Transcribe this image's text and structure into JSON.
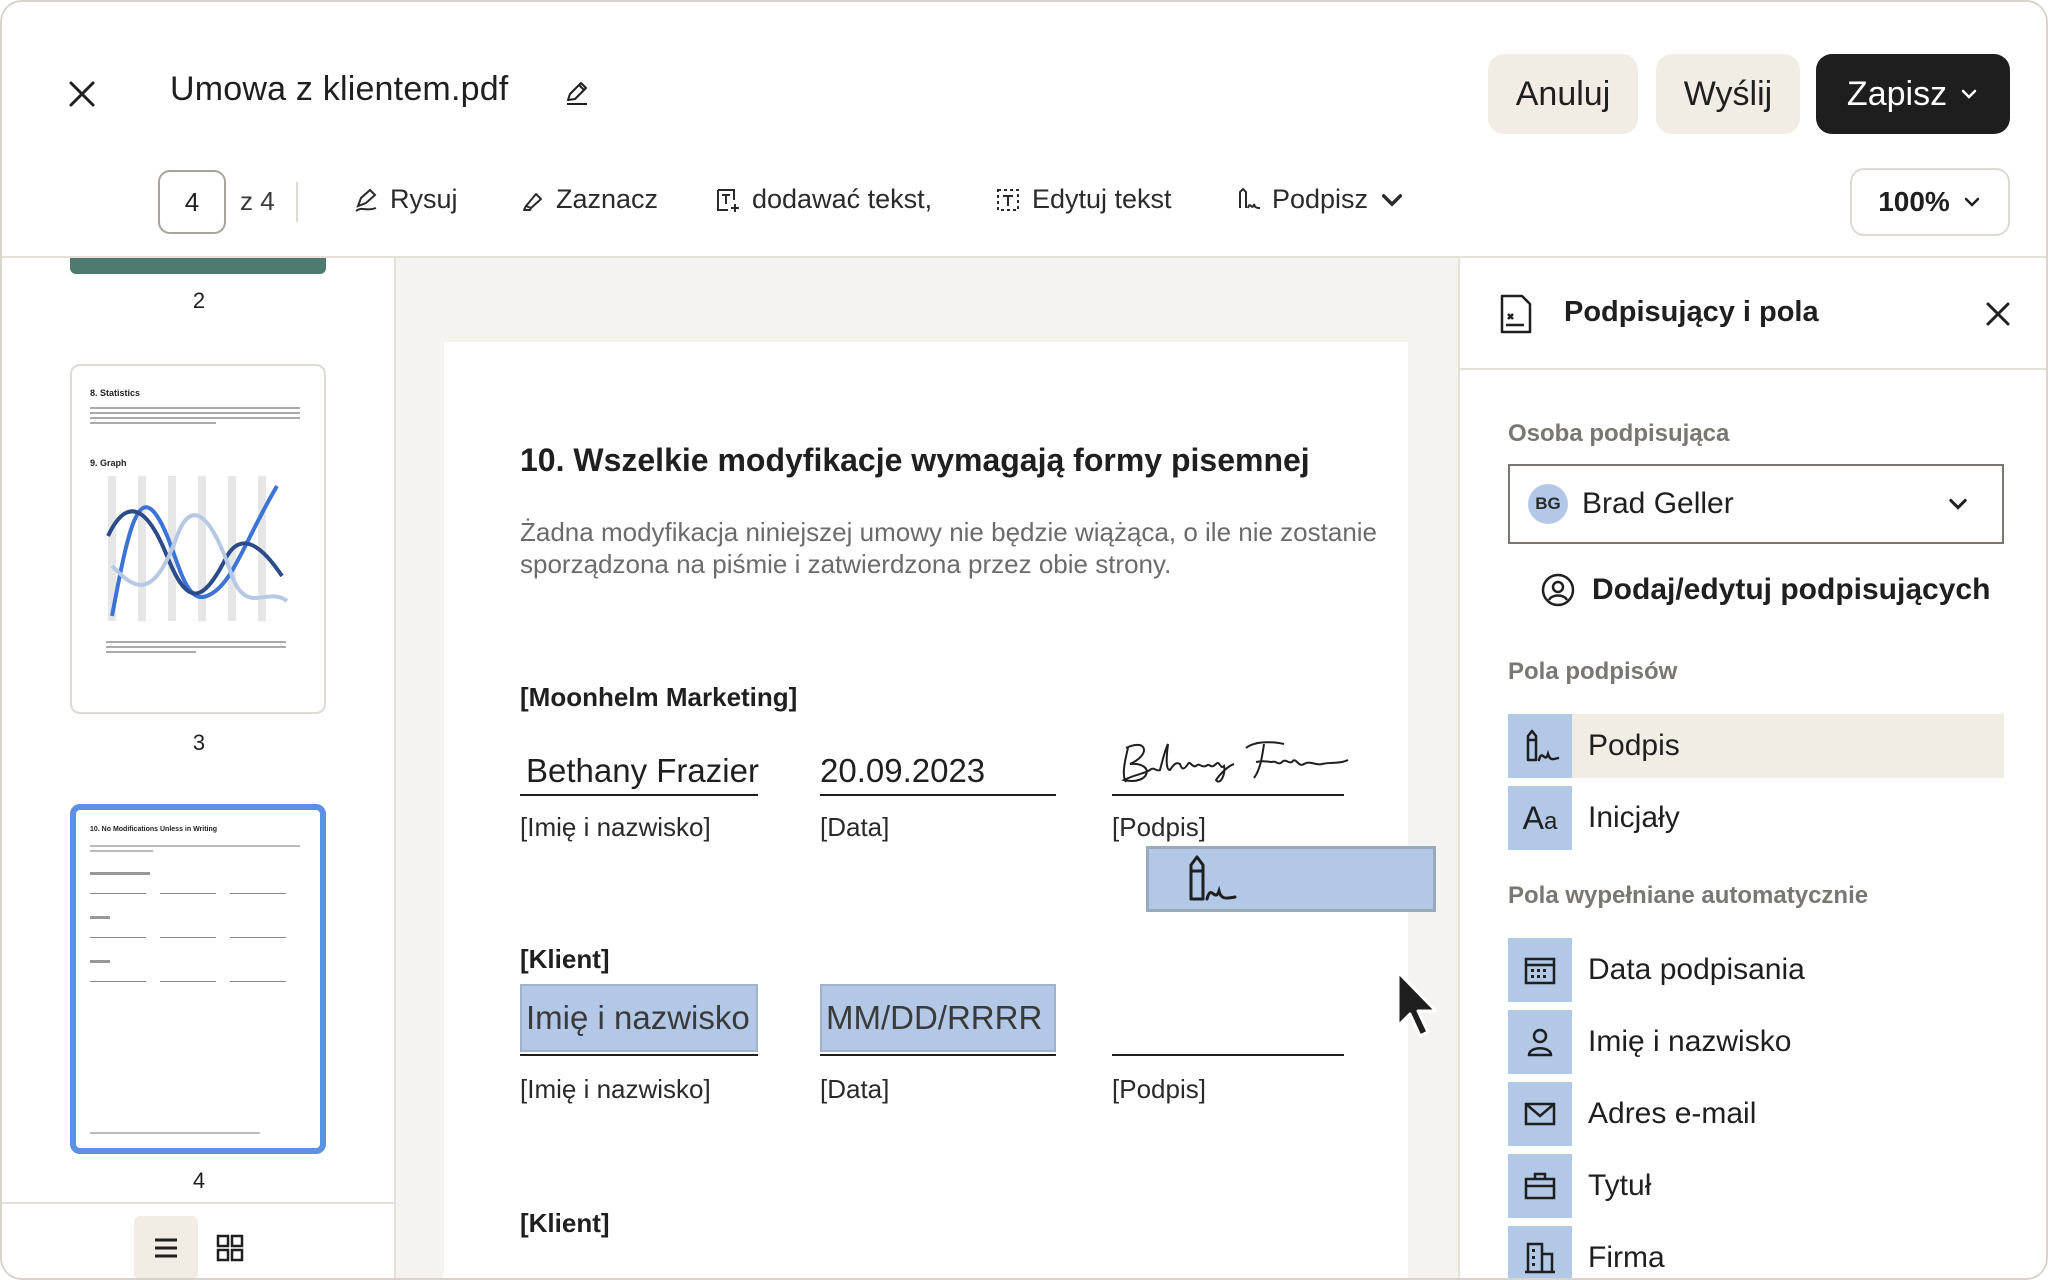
{
  "header": {
    "title": "Umowa z klientem.pdf",
    "cancel": "Anuluj",
    "send": "Wyślij",
    "save": "Zapisz"
  },
  "toolbar": {
    "page_current": "4",
    "page_of": "z 4",
    "tools": [
      "Rysuj",
      "Zaznacz",
      "dodawać tekst,",
      "Edytuj tekst",
      "Podpisz"
    ],
    "zoom": "100%"
  },
  "thumbnails": {
    "numbers": [
      "2",
      "3",
      "4"
    ],
    "page3": {
      "heading1": "8. Statistics",
      "heading2": "9. Graph"
    },
    "page4": {
      "heading": "10. No Modifications Unless in Writing"
    }
  },
  "document": {
    "heading": "10. Wszelkie modyfikacje wymagają formy pisemnej",
    "paragraph": "Żadna modyfikacja niniejszej umowy nie będzie wiążąca, o ile nie zostanie sporządzona na piśmie i zatwierdzona przez obie strony.",
    "party1": "[Moonhelm Marketing]",
    "party1_name": "Bethany Frazier",
    "party1_date": "20.09.2023",
    "party2": "[Klient]",
    "party2_name_placeholder": "Imię i nazwisko",
    "party2_date_placeholder": "MM/DD/RRRR",
    "party3": "[Klient]",
    "label_name": "[Imię i nazwisko]",
    "label_date": "[Data]",
    "label_signature": "[Podpis]"
  },
  "panel": {
    "title": "Podpisujący i pola",
    "signer_section": "Osoba podpisująca",
    "signer_initials": "BG",
    "signer_name": "Brad Geller",
    "add_signers": "Dodaj/edytuj podpisujących",
    "sig_fields_section": "Pola podpisów",
    "sig_fields": [
      "Podpis",
      "Inicjały"
    ],
    "auto_fields_section": "Pola wypełniane automatycznie",
    "auto_fields": [
      "Data podpisania",
      "Imię i nazwisko",
      "Adres e-mail",
      "Tytuł",
      "Firma"
    ]
  },
  "colors": {
    "accent_blue": "#b2c8e6",
    "active_thumb": "#5c8fe6",
    "dark_button": "#1e1e1e",
    "light_button": "#f1ede4"
  }
}
